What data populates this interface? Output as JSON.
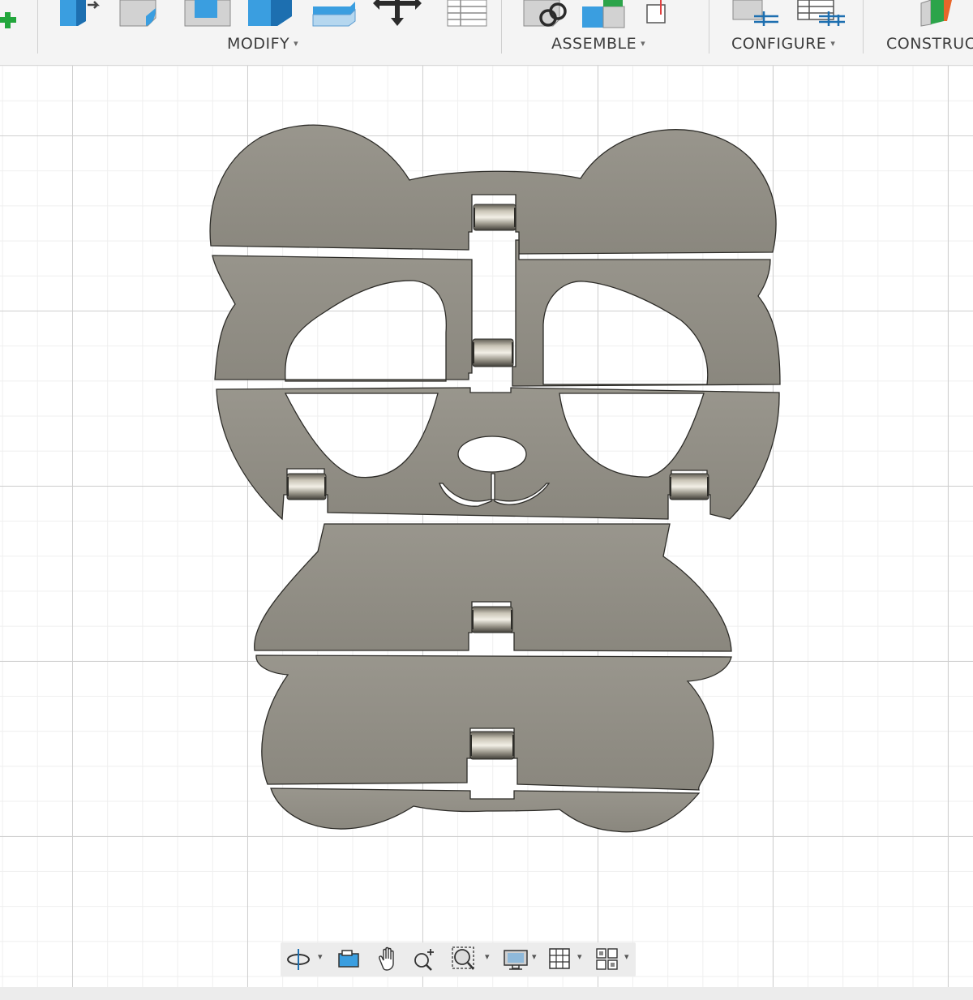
{
  "toolbar": {
    "groups": [
      {
        "label": "MODIFY",
        "has_dropdown": true
      },
      {
        "label": "ASSEMBLE",
        "has_dropdown": true
      },
      {
        "label": "CONFIGURE",
        "has_dropdown": true
      },
      {
        "label": "CONSTRUC",
        "has_dropdown": false
      }
    ],
    "dropdown_glyph": "▾",
    "icons": [
      "add-icon",
      "press-pull-icon",
      "fillet-icon",
      "shell-icon",
      "draft-icon",
      "combine-icon",
      "offset-face-icon",
      "move-icon",
      "change-parameters-icon",
      "joint-icon",
      "rigid-group-icon",
      "as-built-joint-icon",
      "configure-table-icon",
      "configure-rules-icon",
      "offset-plane-icon"
    ]
  },
  "viewport": {
    "model": "panda-hinged-panels",
    "panel_color": "#8f8c83",
    "hinge_count": 6
  },
  "navbar": {
    "items": [
      "orbit-icon",
      "look-at-icon",
      "pan-icon",
      "zoom-icon",
      "fit-window-icon",
      "display-settings-icon",
      "grid-settings-icon",
      "viewports-icon"
    ],
    "dropdown_glyph": "▾"
  }
}
